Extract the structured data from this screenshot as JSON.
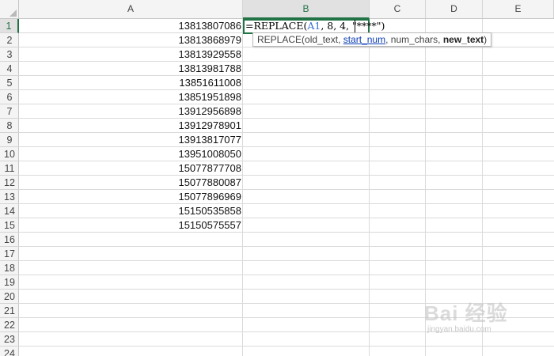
{
  "columns": [
    "A",
    "B",
    "C",
    "D",
    "E"
  ],
  "rows": [
    "1",
    "2",
    "3",
    "4",
    "5",
    "6",
    "7",
    "8",
    "9",
    "10",
    "11",
    "12",
    "13",
    "14",
    "15",
    "16",
    "17",
    "18",
    "19",
    "20",
    "21",
    "22",
    "23",
    "24"
  ],
  "active": {
    "column": "B",
    "row": "1"
  },
  "column_a": [
    "13813807086",
    "13813868979",
    "13813929558",
    "13813981788",
    "13851611008",
    "13851951898",
    "13912956898",
    "13912978901",
    "13913817077",
    "13951008050",
    "15077877708",
    "15077880087",
    "15077896969",
    "15150535858",
    "15150575557"
  ],
  "formula": {
    "prefix": "=REPLACE(",
    "ref": "A1",
    "suffix": ", 8, 4, \"****\")"
  },
  "tooltip": {
    "fn": "REPLACE(",
    "arg1": "old_text",
    "sep1": ", ",
    "arg2": "start_num",
    "sep2": ", ",
    "arg3": "num_chars",
    "sep3": ", ",
    "arg4": "new_text",
    "close": ")"
  },
  "watermark": {
    "text": "Bai 经验",
    "sub": "jingyan.baidu.com"
  }
}
